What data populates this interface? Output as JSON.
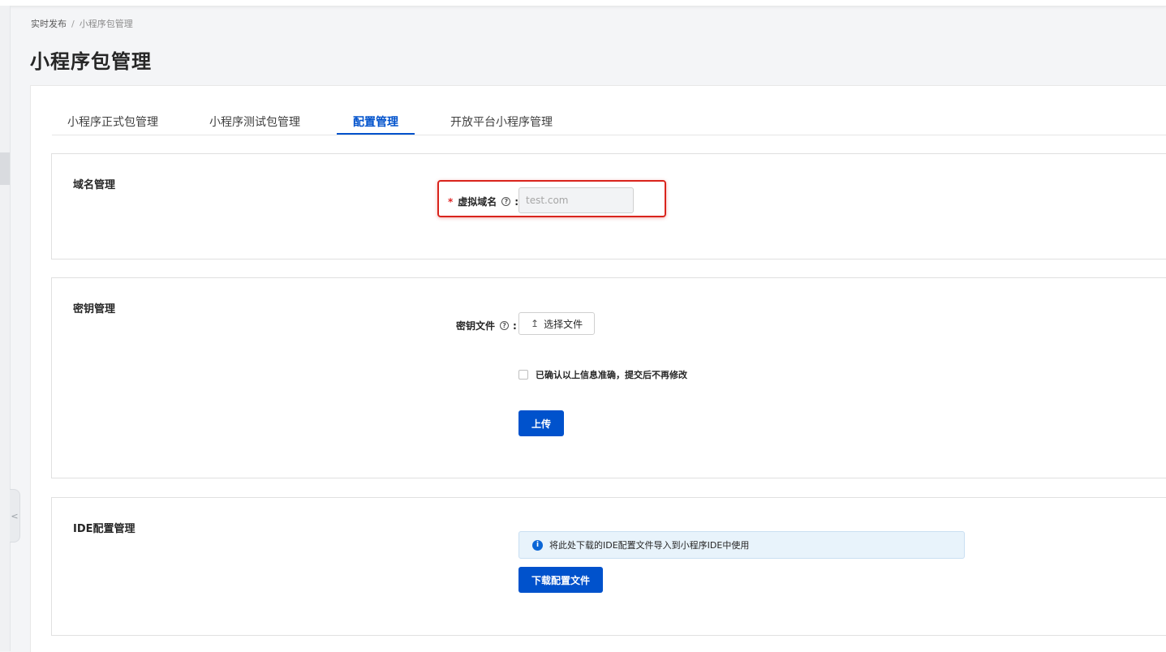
{
  "breadcrumb": {
    "root": "实时发布",
    "separator": "/",
    "current": "小程序包管理"
  },
  "page_title": "小程序包管理",
  "tabs": [
    {
      "label": "小程序正式包管理"
    },
    {
      "label": "小程序测试包管理"
    },
    {
      "label": "配置管理",
      "active": true
    },
    {
      "label": "开放平台小程序管理"
    }
  ],
  "domain_section": {
    "title": "域名管理",
    "required_mark": "*",
    "label": "虚拟域名",
    "help": "?",
    "colon": ":",
    "input_placeholder": "test.com"
  },
  "key_section": {
    "title": "密钥管理",
    "label": "密钥文件",
    "help": "?",
    "colon": ":",
    "upload_icon": "↥",
    "upload_label": "选择文件",
    "confirm_text": "已确认以上信息准确，提交后不再修改",
    "submit_label": "上传"
  },
  "ide_section": {
    "title": "IDE配置管理",
    "info_icon": "i",
    "info_text": "将此处下载的IDE配置文件导入到小程序IDE中使用",
    "download_label": "下载配置文件"
  },
  "sidebar": {
    "collapse_glyph": "<"
  },
  "colors": {
    "primary": "#0052cc",
    "highlight": "#d9241c",
    "info_bg": "#e8f3fb"
  }
}
